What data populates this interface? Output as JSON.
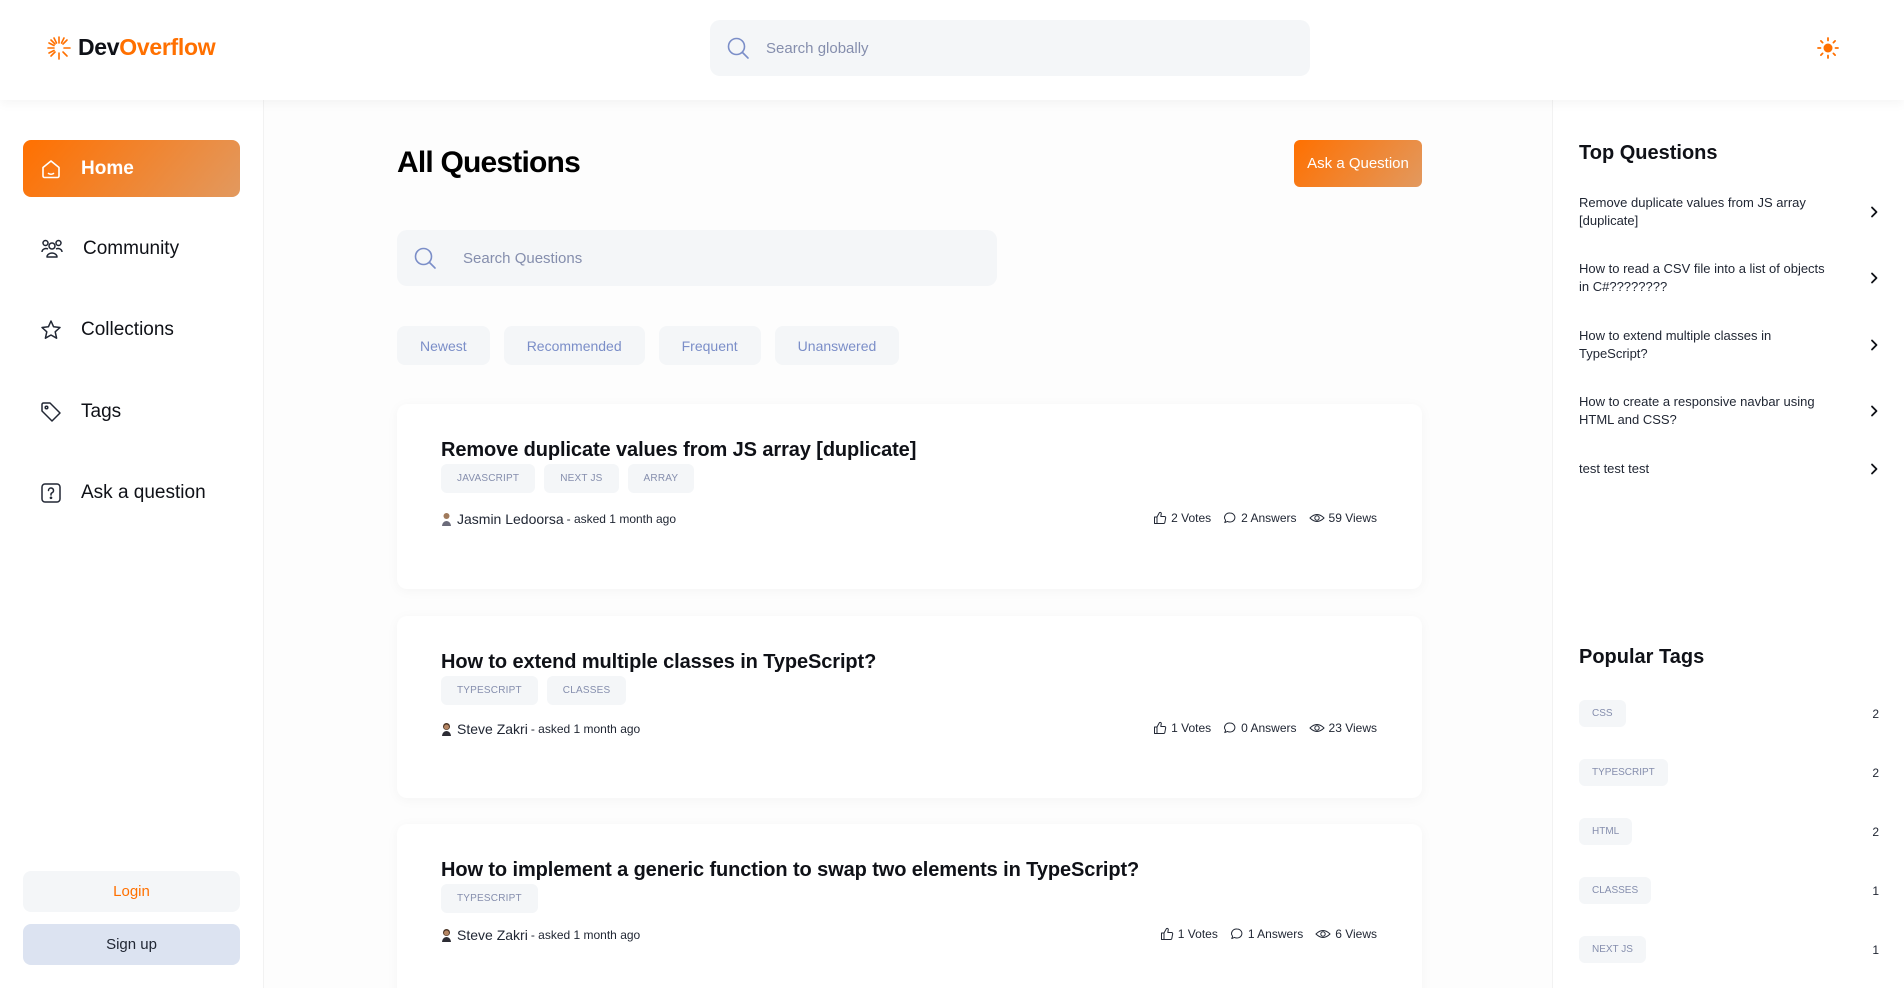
{
  "navbar": {
    "logo_dev": "Dev",
    "logo_overflow": "Overflow",
    "search_placeholder": "Search globally"
  },
  "sidebar": {
    "items": [
      {
        "label": "Home",
        "icon": "home-icon",
        "active": true
      },
      {
        "label": "Community",
        "icon": "users-icon"
      },
      {
        "label": "Collections",
        "icon": "star-icon"
      },
      {
        "label": "Tags",
        "icon": "tag-icon"
      },
      {
        "label": "Ask a question",
        "icon": "question-icon"
      }
    ],
    "login_label": "Login",
    "signup_label": "Sign up"
  },
  "main": {
    "title": "All Questions",
    "ask_button": "Ask a Question",
    "search_placeholder": "Search Questions",
    "filters": [
      "Newest",
      "Recommended",
      "Frequent",
      "Unanswered"
    ],
    "questions": [
      {
        "title": "Remove duplicate values from JS array [duplicate]",
        "tags": [
          "JAVASCRIPT",
          "NEXT JS",
          "ARRAY"
        ],
        "author": "Jasmin Ledoorsa",
        "asked": "- asked 1 month ago",
        "votes": "2 Votes",
        "answers": "2 Answers",
        "views": "59 Views"
      },
      {
        "title": "How to extend multiple classes in TypeScript?",
        "tags": [
          "TYPESCRIPT",
          "CLASSES"
        ],
        "author": "Steve Zakri",
        "asked": "- asked 1 month ago",
        "votes": "1 Votes",
        "answers": "0 Answers",
        "views": "23 Views"
      },
      {
        "title": "How to implement a generic function to swap two elements in TypeScript?",
        "tags": [
          "TYPESCRIPT"
        ],
        "author": "Steve Zakri",
        "asked": "- asked 1 month ago",
        "votes": "1 Votes",
        "answers": "1 Answers",
        "views": "6 Views"
      }
    ]
  },
  "right": {
    "top_questions_heading": "Top Questions",
    "top_questions": [
      "Remove duplicate values from JS array [duplicate]",
      "How to read a CSV file into a list of objects in C#????????",
      "How to extend multiple classes in TypeScript?",
      "How to create a responsive navbar using HTML and CSS?",
      "test test test"
    ],
    "popular_tags_heading": "Popular Tags",
    "popular_tags": [
      {
        "name": "CSS",
        "count": "2"
      },
      {
        "name": "TYPESCRIPT",
        "count": "2"
      },
      {
        "name": "HTML",
        "count": "2"
      },
      {
        "name": "CLASSES",
        "count": "1"
      },
      {
        "name": "NEXT JS",
        "count": "1"
      }
    ]
  },
  "colors": {
    "brand": "#ff7000",
    "brand_gradient_end": "#e2995f",
    "surface": "#f4f6f8",
    "muted_text": "#858ead"
  }
}
